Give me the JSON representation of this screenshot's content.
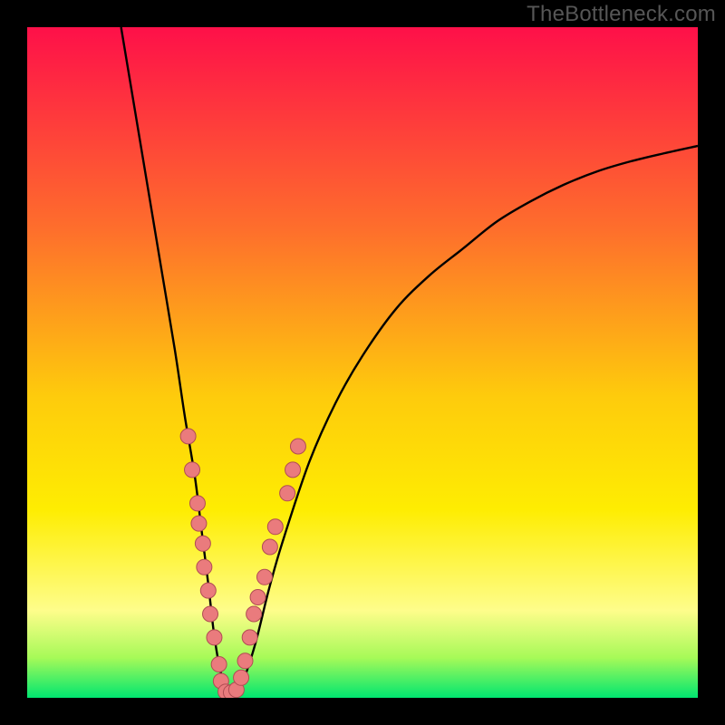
{
  "watermark": "TheBottleneck.com",
  "colors": {
    "frame_bg": "#000000",
    "watermark": "#565656",
    "gradient_top": "#fe1049",
    "gradient_mid1": "#fe6e2c",
    "gradient_mid2": "#fecb0c",
    "gradient_mid3": "#feed02",
    "gradient_mid4": "#fefd8b",
    "gradient_mid5": "#a7fa58",
    "gradient_bottom": "#00e670",
    "curve_stroke": "#000000",
    "dot_fill": "#ea7b7d",
    "dot_stroke": "#b04d53"
  },
  "chart_data": {
    "type": "line",
    "title": "",
    "xlabel": "",
    "ylabel": "",
    "xlim": [
      0,
      100
    ],
    "ylim": [
      0,
      100
    ],
    "annotations": [
      "TheBottleneck.com"
    ],
    "series": [
      {
        "name": "curve",
        "x": [
          14,
          16,
          18,
          20,
          22,
          23.5,
          25,
          26,
          27,
          27.8,
          28.6,
          29.4,
          30.2,
          31,
          32,
          34,
          36,
          38,
          42,
          46,
          50,
          55,
          60,
          65,
          70,
          75,
          80,
          85,
          90,
          95,
          100
        ],
        "y": [
          100,
          88,
          76,
          64,
          52,
          42,
          33,
          25,
          17,
          10,
          5,
          2,
          0.8,
          0.8,
          2,
          8,
          16,
          23,
          35,
          44,
          51,
          58,
          63,
          67,
          71,
          74,
          76.5,
          78.5,
          80,
          81.2,
          82.3
        ]
      }
    ],
    "markers": {
      "name": "dots",
      "points": [
        {
          "x": 24.0,
          "y": 39.0
        },
        {
          "x": 24.6,
          "y": 34.0
        },
        {
          "x": 25.4,
          "y": 29.0
        },
        {
          "x": 25.6,
          "y": 26.0
        },
        {
          "x": 26.2,
          "y": 23.0
        },
        {
          "x": 26.4,
          "y": 19.5
        },
        {
          "x": 27.0,
          "y": 16.0
        },
        {
          "x": 27.3,
          "y": 12.5
        },
        {
          "x": 27.9,
          "y": 9.0
        },
        {
          "x": 28.6,
          "y": 5.0
        },
        {
          "x": 28.9,
          "y": 2.5
        },
        {
          "x": 29.6,
          "y": 0.9
        },
        {
          "x": 30.4,
          "y": 0.8
        },
        {
          "x": 31.2,
          "y": 1.2
        },
        {
          "x": 31.9,
          "y": 3.0
        },
        {
          "x": 32.5,
          "y": 5.5
        },
        {
          "x": 33.2,
          "y": 9.0
        },
        {
          "x": 33.8,
          "y": 12.5
        },
        {
          "x": 34.4,
          "y": 15.0
        },
        {
          "x": 35.4,
          "y": 18.0
        },
        {
          "x": 36.2,
          "y": 22.5
        },
        {
          "x": 37.0,
          "y": 25.5
        },
        {
          "x": 38.8,
          "y": 30.5
        },
        {
          "x": 39.6,
          "y": 34.0
        },
        {
          "x": 40.4,
          "y": 37.5
        }
      ]
    },
    "gradient_stops": [
      {
        "offset": 0.0,
        "color": "#fe1049"
      },
      {
        "offset": 0.3,
        "color": "#fe6e2c"
      },
      {
        "offset": 0.55,
        "color": "#fecb0c"
      },
      {
        "offset": 0.72,
        "color": "#feed02"
      },
      {
        "offset": 0.87,
        "color": "#fefd8b"
      },
      {
        "offset": 0.94,
        "color": "#a7fa58"
      },
      {
        "offset": 1.0,
        "color": "#00e670"
      }
    ]
  }
}
